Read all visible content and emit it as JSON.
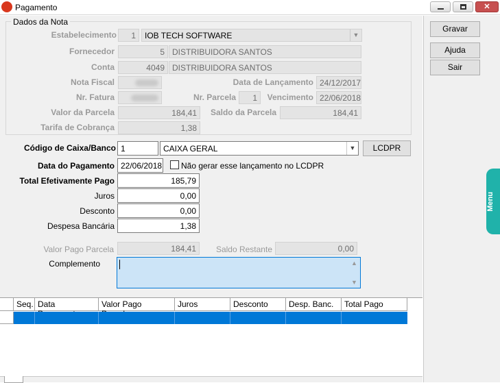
{
  "window": {
    "title": "Pagamento"
  },
  "group_title": "Dados da Nota",
  "nota": {
    "estabelecimento_label": "Estabelecimento",
    "estabelecimento_code": "1",
    "estabelecimento_name": "IOB TECH SOFTWARE",
    "fornecedor_label": "Fornecedor",
    "fornecedor_code": "5",
    "fornecedor_name": "DISTRIBUIDORA SANTOS",
    "conta_label": "Conta",
    "conta_code": "4049",
    "conta_name": "DISTRIBUIDORA SANTOS",
    "nota_fiscal_label": "Nota Fiscal",
    "data_lancamento_label": "Data de Lançamento",
    "data_lancamento": "24/12/2017",
    "nr_fatura_label": "Nr. Fatura",
    "nr_parcela_label": "Nr. Parcela",
    "nr_parcela": "1",
    "vencimento_label": "Vencimento",
    "vencimento": "22/06/2018",
    "valor_parcela_label": "Valor da Parcela",
    "valor_parcela": "184,41",
    "saldo_parcela_label": "Saldo da Parcela",
    "saldo_parcela": "184,41",
    "tarifa_label": "Tarifa de Cobrança",
    "tarifa": "1,38"
  },
  "pagamento": {
    "codigo_caixa_label": "Código de Caixa/Banco",
    "codigo_caixa": "1",
    "caixa_nome": "CAIXA GERAL",
    "lcdpr_button": "LCDPR",
    "data_pagamento_label": "Data do Pagamento",
    "data_pagamento": "22/06/2018",
    "nao_gerar_label": "Não gerar esse lançamento no LCDPR",
    "total_label": "Total Efetivamente Pago",
    "total": "185,79",
    "juros_label": "Juros",
    "juros": "0,00",
    "desconto_label": "Desconto",
    "desconto": "0,00",
    "despesa_label": "Despesa Bancária",
    "despesa": "1,38",
    "valor_pago_parcela_label": "Valor Pago Parcela",
    "valor_pago_parcela": "184,41",
    "saldo_restante_label": "Saldo Restante",
    "saldo_restante": "0,00",
    "complemento_label": "Complemento",
    "complemento": ""
  },
  "grid": {
    "columns": [
      "Seq.",
      "Data Pagamento",
      "Valor Pago Parcela",
      "Juros",
      "Desconto",
      "Desp. Banc.",
      "Total Pago"
    ]
  },
  "side_buttons": {
    "gravar": "Gravar",
    "ajuda": "Ajuda",
    "sair": "Sair"
  },
  "menu_tab": "Menu",
  "colors": {
    "selection": "#0078d7",
    "menu_tab": "#20b2aa",
    "complemento_bg": "#cce4f7"
  }
}
